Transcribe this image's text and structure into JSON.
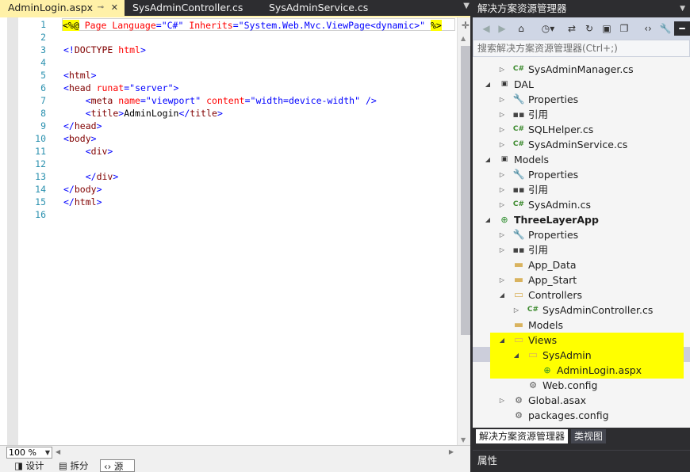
{
  "tabs": [
    {
      "label": "AdminLogin.aspx",
      "active": true
    },
    {
      "label": "SysAdminController.cs",
      "active": false
    },
    {
      "label": "SysAdminService.cs",
      "active": false
    }
  ],
  "editor": {
    "line_numbers": [
      "1",
      "2",
      "3",
      "4",
      "5",
      "6",
      "7",
      "8",
      "9",
      "10",
      "11",
      "12",
      "13",
      "14",
      "15",
      "16"
    ],
    "lines": [
      [
        {
          "t": "aspx",
          "v": "<%@"
        },
        {
          "t": "txt",
          "v": " "
        },
        {
          "t": "attr",
          "v": "Page"
        },
        {
          "t": "txt",
          "v": " "
        },
        {
          "t": "attr",
          "v": "Language"
        },
        {
          "t": "kw",
          "v": "="
        },
        {
          "t": "val",
          "v": "\"C#\""
        },
        {
          "t": "txt",
          "v": " "
        },
        {
          "t": "attr",
          "v": "Inherits"
        },
        {
          "t": "kw",
          "v": "="
        },
        {
          "t": "val",
          "v": "\"System.Web.Mvc.ViewPage<dynamic>\""
        },
        {
          "t": "txt",
          "v": " "
        },
        {
          "t": "aspx",
          "v": "%>"
        }
      ],
      [],
      [
        {
          "t": "kw",
          "v": "<!"
        },
        {
          "t": "tag",
          "v": "DOCTYPE"
        },
        {
          "t": "txt",
          "v": " "
        },
        {
          "t": "attr",
          "v": "html"
        },
        {
          "t": "kw",
          "v": ">"
        }
      ],
      [],
      [
        {
          "t": "kw",
          "v": "<"
        },
        {
          "t": "tag",
          "v": "html"
        },
        {
          "t": "kw",
          "v": ">"
        }
      ],
      [
        {
          "t": "kw",
          "v": "<"
        },
        {
          "t": "tag",
          "v": "head"
        },
        {
          "t": "txt",
          "v": " "
        },
        {
          "t": "attr",
          "v": "runat"
        },
        {
          "t": "kw",
          "v": "="
        },
        {
          "t": "val",
          "v": "\"server\""
        },
        {
          "t": "kw",
          "v": ">"
        }
      ],
      [
        {
          "t": "txt",
          "v": "    "
        },
        {
          "t": "kw",
          "v": "<"
        },
        {
          "t": "tag",
          "v": "meta"
        },
        {
          "t": "txt",
          "v": " "
        },
        {
          "t": "attr",
          "v": "name"
        },
        {
          "t": "kw",
          "v": "="
        },
        {
          "t": "val",
          "v": "\"viewport\""
        },
        {
          "t": "txt",
          "v": " "
        },
        {
          "t": "attr",
          "v": "content"
        },
        {
          "t": "kw",
          "v": "="
        },
        {
          "t": "val",
          "v": "\"width=device-width\""
        },
        {
          "t": "txt",
          "v": " "
        },
        {
          "t": "kw",
          "v": "/>"
        }
      ],
      [
        {
          "t": "txt",
          "v": "    "
        },
        {
          "t": "kw",
          "v": "<"
        },
        {
          "t": "tag",
          "v": "title"
        },
        {
          "t": "kw",
          "v": ">"
        },
        {
          "t": "txt",
          "v": "AdminLogin"
        },
        {
          "t": "kw",
          "v": "</"
        },
        {
          "t": "tag",
          "v": "title"
        },
        {
          "t": "kw",
          "v": ">"
        }
      ],
      [
        {
          "t": "kw",
          "v": "</"
        },
        {
          "t": "tag",
          "v": "head"
        },
        {
          "t": "kw",
          "v": ">"
        }
      ],
      [
        {
          "t": "kw",
          "v": "<"
        },
        {
          "t": "tag",
          "v": "body"
        },
        {
          "t": "kw",
          "v": ">"
        }
      ],
      [
        {
          "t": "txt",
          "v": "    "
        },
        {
          "t": "kw",
          "v": "<"
        },
        {
          "t": "tag",
          "v": "div"
        },
        {
          "t": "kw",
          "v": ">"
        }
      ],
      [],
      [
        {
          "t": "txt",
          "v": "    "
        },
        {
          "t": "kw",
          "v": "</"
        },
        {
          "t": "tag",
          "v": "div"
        },
        {
          "t": "kw",
          "v": ">"
        }
      ],
      [
        {
          "t": "kw",
          "v": "</"
        },
        {
          "t": "tag",
          "v": "body"
        },
        {
          "t": "kw",
          "v": ">"
        }
      ],
      [
        {
          "t": "kw",
          "v": "</"
        },
        {
          "t": "tag",
          "v": "html"
        },
        {
          "t": "kw",
          "v": ">"
        }
      ],
      []
    ]
  },
  "editor_bottom": {
    "zoom": "100 %",
    "view_design": "设计",
    "view_split": "拆分",
    "view_source": "源"
  },
  "solution_explorer": {
    "title": "解决方案资源管理器",
    "search_placeholder": "搜索解决方案资源管理器(Ctrl+;)",
    "items": [
      {
        "label": "SysAdminManager.cs",
        "icon": "cs",
        "indent": 1,
        "expander": "collapsed"
      },
      {
        "label": "DAL",
        "icon": "project",
        "indent": 0,
        "expander": "expanded"
      },
      {
        "label": "Properties",
        "icon": "wrench",
        "indent": 1,
        "expander": "collapsed"
      },
      {
        "label": "引用",
        "icon": "reference",
        "indent": 1,
        "expander": "collapsed"
      },
      {
        "label": "SQLHelper.cs",
        "icon": "cs",
        "indent": 1,
        "expander": "collapsed"
      },
      {
        "label": "SysAdminService.cs",
        "icon": "cs",
        "indent": 1,
        "expander": "collapsed"
      },
      {
        "label": "Models",
        "icon": "project",
        "indent": 0,
        "expander": "expanded"
      },
      {
        "label": "Properties",
        "icon": "wrench",
        "indent": 1,
        "expander": "collapsed"
      },
      {
        "label": "引用",
        "icon": "reference",
        "indent": 1,
        "expander": "collapsed"
      },
      {
        "label": "SysAdmin.cs",
        "icon": "cs",
        "indent": 1,
        "expander": "collapsed"
      },
      {
        "label": "ThreeLayerApp",
        "icon": "web-project",
        "indent": 0,
        "expander": "expanded",
        "bold": true
      },
      {
        "label": "Properties",
        "icon": "wrench",
        "indent": 1,
        "expander": "collapsed"
      },
      {
        "label": "引用",
        "icon": "reference",
        "indent": 1,
        "expander": "collapsed"
      },
      {
        "label": "App_Data",
        "icon": "folder",
        "indent": 1,
        "expander": "none"
      },
      {
        "label": "App_Start",
        "icon": "folder",
        "indent": 1,
        "expander": "collapsed"
      },
      {
        "label": "Controllers",
        "icon": "folder-open",
        "indent": 1,
        "expander": "expanded"
      },
      {
        "label": "SysAdminController.cs",
        "icon": "cs",
        "indent": 2,
        "expander": "collapsed"
      },
      {
        "label": "Models",
        "icon": "folder",
        "indent": 1,
        "expander": "none"
      },
      {
        "label": "Views",
        "icon": "folder-open",
        "indent": 1,
        "expander": "expanded"
      },
      {
        "label": "SysAdmin",
        "icon": "folder-open",
        "indent": 2,
        "expander": "expanded"
      },
      {
        "label": "AdminLogin.aspx",
        "icon": "web-file",
        "indent": 3,
        "expander": "none"
      },
      {
        "label": "Web.config",
        "icon": "config",
        "indent": 2,
        "expander": "none"
      },
      {
        "label": "Global.asax",
        "icon": "config",
        "indent": 1,
        "expander": "collapsed"
      },
      {
        "label": "packages.config",
        "icon": "config",
        "indent": 1,
        "expander": "none"
      }
    ],
    "bottom_tabs": [
      "解决方案资源管理器",
      "类视图"
    ]
  },
  "properties_panel": {
    "title": "属性"
  },
  "colors": {
    "highlight": "#ffff00",
    "active_tab": "#fff1a8",
    "chrome": "#2d2d30"
  }
}
